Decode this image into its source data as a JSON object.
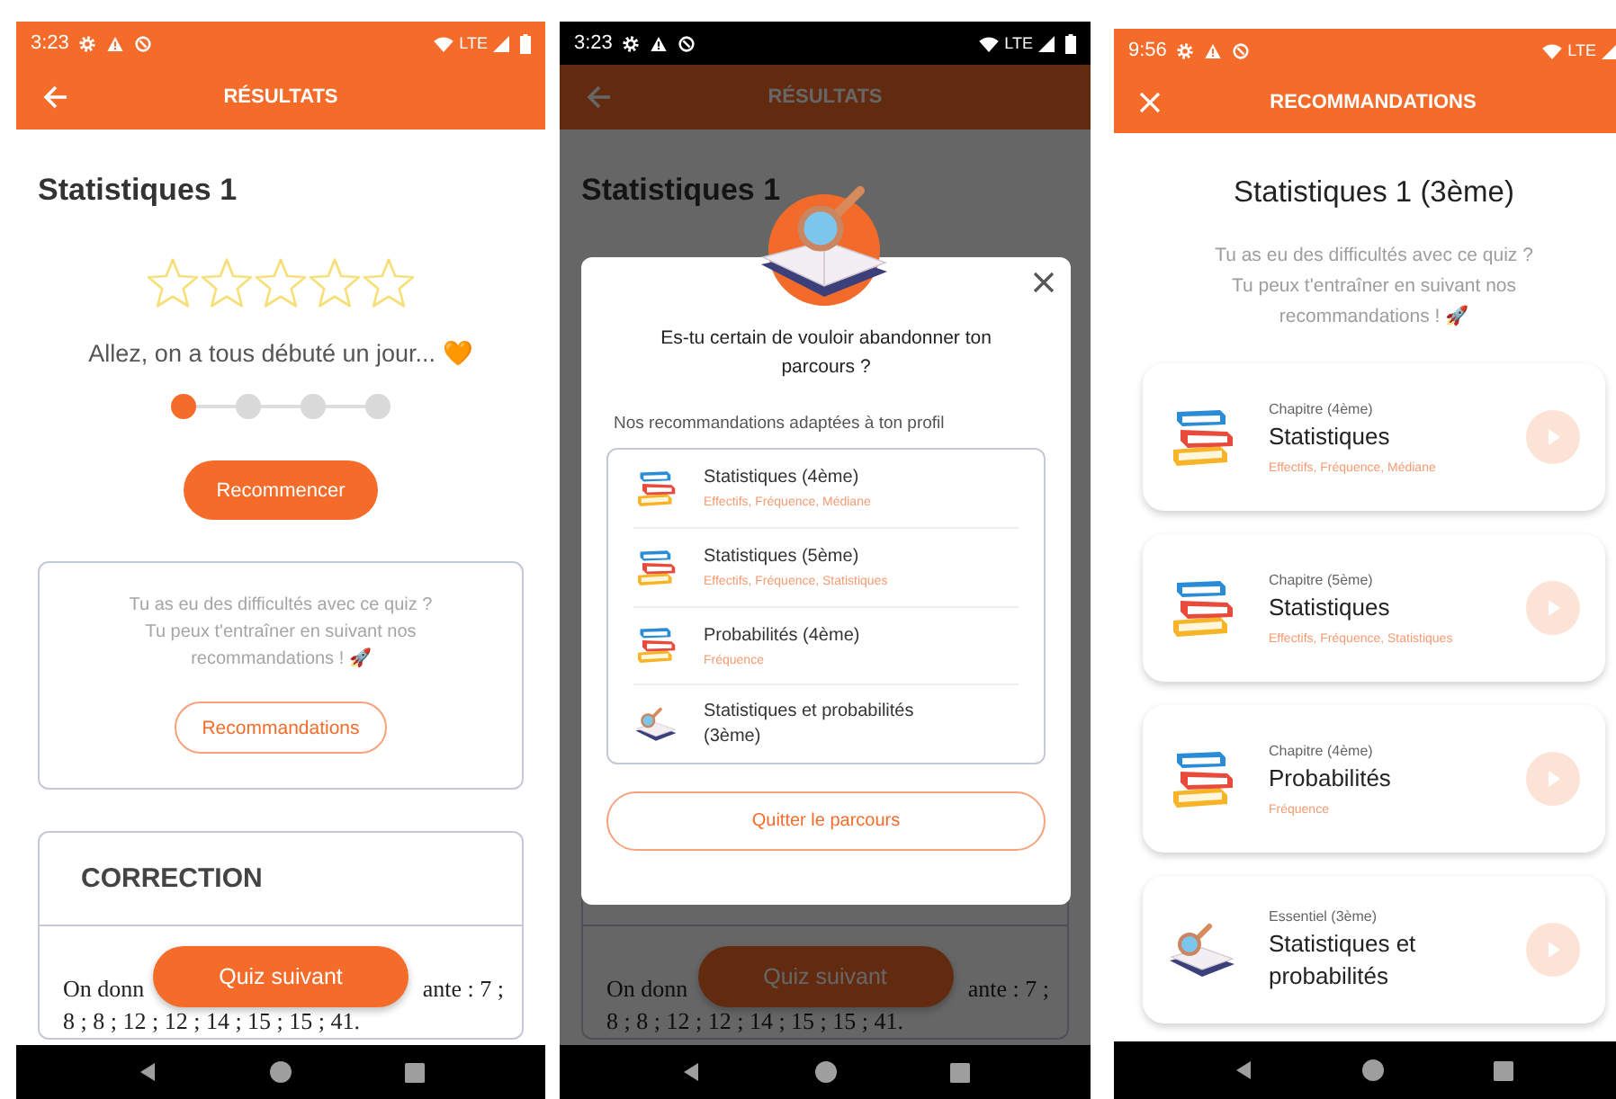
{
  "screens": [
    {
      "kind": "results",
      "status_bar": {
        "time": "3:23",
        "network": "LTE"
      },
      "app_bar": {
        "title": "RÉSULTATS"
      },
      "title": "Statistiques 1",
      "stars": 0,
      "message": "Allez, on a tous débuté un jour... 🧡",
      "steps": [
        {
          "done": true
        },
        {
          "done": false
        },
        {
          "done": false
        },
        {
          "done": false
        }
      ],
      "restart_button": "Recommencer",
      "help_card": {
        "lines": [
          "Tu as eu des difficultés avec ce quiz ?",
          "Tu peux t'entraîner en suivant nos",
          "recommandations ! 🚀"
        ],
        "button": "Recommandations"
      },
      "correction": {
        "title": "CORRECTION",
        "question_start": "On donn",
        "question_end": "ante : 7 ;",
        "question_line_2": "8 ; 8 ; 12 ; 12 ; 14 ; 15 ; 15 ; 41."
      },
      "next_button": "Quiz suivant"
    },
    {
      "kind": "dialog",
      "status_bar": {
        "time": "3:23",
        "network": "LTE"
      },
      "app_bar": {
        "title": "RÉSULTATS"
      },
      "title": "Statistiques 1",
      "correction": {
        "question_start": "On donn",
        "question_end": "ante : 7 ;",
        "question_line_2": "8 ; 8 ; 12 ; 12 ; 14 ; 15 ; 15 ; 41."
      },
      "next_button": "Quiz suivant",
      "dialog": {
        "question": "Es-tu certain de vouloir abandonner ton parcours ?",
        "subtitle": "Nos recommandations adaptées à ton profil",
        "items": [
          {
            "kind": "chapter",
            "title": "Statistiques (4ème)",
            "tags": "Effectifs, Fréquence, Médiane"
          },
          {
            "kind": "chapter",
            "title": "Statistiques (5ème)",
            "tags": "Effectifs, Fréquence, Statistiques"
          },
          {
            "kind": "chapter",
            "title": "Probabilités (4ème)",
            "tags": "Fréquence"
          },
          {
            "kind": "essential",
            "title": "Statistiques et probabilités (3ème)"
          }
        ],
        "button": "Quitter le parcours"
      }
    },
    {
      "kind": "recommendations",
      "status_bar": {
        "time": "9:56",
        "network": "LTE"
      },
      "app_bar": {
        "title": "RECOMMANDATIONS"
      },
      "title": "Statistiques 1 (3ème)",
      "lines": [
        "Tu as eu des difficultés avec ce quiz ?",
        "Tu peux t'entraîner en suivant nos",
        "recommandations ! 🚀"
      ],
      "cards": [
        {
          "kind": "chapter",
          "category": "Chapitre (4ème)",
          "title": "Statistiques",
          "tags": "Effectifs, Fréquence, Médiane"
        },
        {
          "kind": "chapter",
          "category": "Chapitre (5ème)",
          "title": "Statistiques",
          "tags": "Effectifs, Fréquence, Statistiques"
        },
        {
          "kind": "chapter",
          "category": "Chapitre (4ème)",
          "title": "Probabilités",
          "tags": "Fréquence"
        },
        {
          "kind": "essential",
          "category": "Essentiel (3ème)",
          "title": "Statistiques et probabilités"
        }
      ]
    }
  ]
}
